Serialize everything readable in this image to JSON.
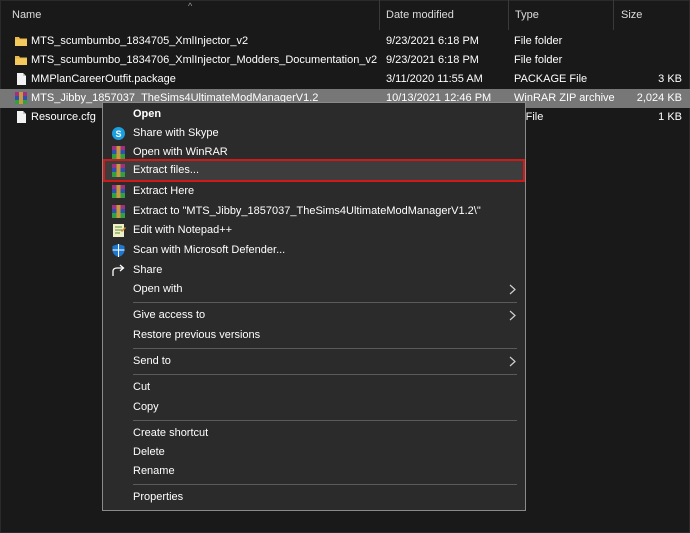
{
  "columns": {
    "name": "Name",
    "date_modified": "Date modified",
    "type": "Type",
    "size": "Size"
  },
  "files": [
    {
      "name": "MTS_scumbumbo_1834705_XmlInjector_v2",
      "date": "9/23/2021 6:18 PM",
      "type": "File folder",
      "size": "",
      "icon": "folder-icon"
    },
    {
      "name": "MTS_scumbumbo_1834706_XmlInjector_Modders_Documentation_v2",
      "date": "9/23/2021 6:18 PM",
      "type": "File folder",
      "size": "",
      "icon": "folder-icon"
    },
    {
      "name": "MMPlanCareerOutfit.package",
      "date": "3/11/2020 11:55 AM",
      "type": "PACKAGE File",
      "size": "3 KB",
      "icon": "file-icon"
    },
    {
      "name": "MTS_Jibby_1857037_TheSims4UltimateModManagerV1.2",
      "date": "10/13/2021 12:46 PM",
      "type": "WinRAR ZIP archive",
      "size": "2,024 KB",
      "icon": "winrar-icon"
    },
    {
      "name": "Resource.cfg",
      "date": "",
      "type": "G File",
      "size": "1 KB",
      "icon": "file-icon"
    }
  ],
  "menu": {
    "open": "Open",
    "share_skype": "Share with Skype",
    "open_winrar": "Open with WinRAR",
    "extract_files": "Extract files...",
    "extract_here": "Extract Here",
    "extract_to": "Extract to \"MTS_Jibby_1857037_TheSims4UltimateModManagerV1.2\\\"",
    "edit_notepad": "Edit with Notepad++",
    "scan_defender": "Scan with Microsoft Defender...",
    "share": "Share",
    "open_with": "Open with",
    "give_access": "Give access to",
    "restore_versions": "Restore previous versions",
    "send_to": "Send to",
    "cut": "Cut",
    "copy": "Copy",
    "create_shortcut": "Create shortcut",
    "delete": "Delete",
    "rename": "Rename",
    "properties": "Properties"
  },
  "colors": {
    "background": "#191919",
    "selected_row": "#777777",
    "menu_bg": "#2b2b2b",
    "highlight_border": "#d01a1a",
    "folder": "#e8b84a"
  }
}
